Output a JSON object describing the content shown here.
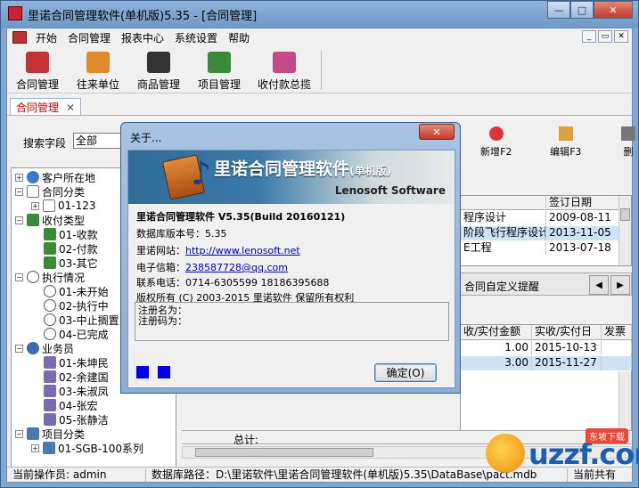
{
  "window": {
    "title": "里诺合同管理软件(单机版)5.35 - [合同管理]",
    "controls": [
      "—",
      "□",
      "✕"
    ]
  },
  "menu": {
    "items": [
      "开始",
      "合同管理",
      "报表中心",
      "系统设置",
      "帮助"
    ],
    "mdi_controls": [
      "_",
      "▭",
      "✕"
    ]
  },
  "toolbar": {
    "buttons": [
      {
        "label": "合同管理",
        "icon": "contract-icon",
        "color": "#c33333"
      },
      {
        "label": "往来单位",
        "icon": "contacts-icon",
        "color": "#e08a2a"
      },
      {
        "label": "商品管理",
        "icon": "goods-icon",
        "color": "#333333"
      },
      {
        "label": "项目管理",
        "icon": "project-icon",
        "color": "#3a8a3a"
      },
      {
        "label": "收付款总揽",
        "icon": "payment-icon",
        "color": "#c44a8a"
      }
    ]
  },
  "doc_tab": {
    "label": "合同管理",
    "close": "✕"
  },
  "search": {
    "label": "搜索字段",
    "value": "全部"
  },
  "actions": {
    "add": "新增F2",
    "edit": "编辑F3",
    "delete": "删"
  },
  "tree": {
    "nodes": [
      {
        "label": "客户所在地",
        "level": 0,
        "exp": "+"
      },
      {
        "label": "合同分类",
        "level": 0,
        "exp": "−"
      },
      {
        "label": "01-123",
        "level": 1,
        "exp": "+"
      },
      {
        "label": "收付类型",
        "level": 0,
        "exp": "−"
      },
      {
        "label": "01-收款",
        "level": 1,
        "exp": ""
      },
      {
        "label": "02-付款",
        "level": 1,
        "exp": ""
      },
      {
        "label": "03-其它",
        "level": 1,
        "exp": ""
      },
      {
        "label": "执行情况",
        "level": 0,
        "exp": "−"
      },
      {
        "label": "01-未开始",
        "level": 1,
        "exp": ""
      },
      {
        "label": "02-执行中",
        "level": 1,
        "exp": ""
      },
      {
        "label": "03-中止搁置",
        "level": 1,
        "exp": ""
      },
      {
        "label": "04-已完成",
        "level": 1,
        "exp": ""
      },
      {
        "label": "业务员",
        "level": 0,
        "exp": "−"
      },
      {
        "label": "01-朱坤民",
        "level": 1,
        "exp": ""
      },
      {
        "label": "02-余建国",
        "level": 1,
        "exp": ""
      },
      {
        "label": "03-朱淑凤",
        "level": 1,
        "exp": ""
      },
      {
        "label": "04-张宏",
        "level": 1,
        "exp": ""
      },
      {
        "label": "05-张静洁",
        "level": 1,
        "exp": ""
      },
      {
        "label": "项目分类",
        "level": 0,
        "exp": "−"
      },
      {
        "label": "01-SGB-100系列",
        "level": 1,
        "exp": "+"
      }
    ]
  },
  "grid1": {
    "headers": [
      "",
      "签订日期"
    ],
    "rows": [
      [
        "程序设计",
        "2009-08-11"
      ],
      [
        "阶段飞行程序设计",
        "2013-11-05"
      ],
      [
        "E工程",
        "2013-07-18"
      ]
    ]
  },
  "tabs2": {
    "label": "合同自定义提醒",
    "prev": "◀",
    "next": "▶"
  },
  "grid2": {
    "headers": [
      "收/实付金额",
      "实收/实付日",
      "发票"
    ],
    "rows": [
      [
        "1.00",
        "2015-10-13",
        ""
      ],
      [
        "3.00",
        "2015-11-27",
        ""
      ]
    ]
  },
  "totals": {
    "label": "总计:"
  },
  "status": {
    "operator": "当前操作员: admin",
    "db_path": "数据库路径：D:\\里诺软件\\里诺合同管理软件(单机版)5.35\\DataBase\\pact.mdb",
    "total": "当前共有"
  },
  "watermark": {
    "text": "uzzf.com",
    "badge": "东坡下载"
  },
  "about": {
    "title": "关于...",
    "close": "✕",
    "banner_title": "里诺合同管理软件",
    "banner_sub": "(单机版)",
    "banner_company": "Lenosoft Software",
    "product": "里诺合同管理软件  V5.35(Build 20160121)",
    "db_version": "数据库版本号：5.35",
    "website_label": "里诺网站：",
    "website": "http://www.lenosoft.net",
    "email_label": "电子信箱：",
    "email": "238587728@qq.com",
    "phone": "联系电话：0714-6305599  18186395688",
    "copyright": "版权所有 (C) 2003-2015 里诺软件 保留所有权利",
    "reg_name": "注册名为：",
    "reg_code": "注册码为：",
    "ok": "确定(O)"
  }
}
